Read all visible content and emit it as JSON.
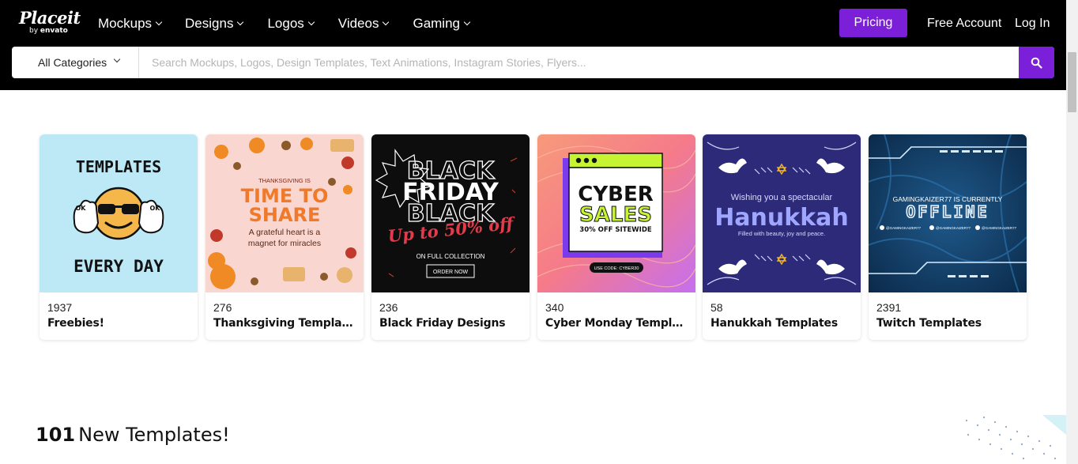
{
  "brand": {
    "name": "Placeit",
    "by": "by",
    "parent": "envato"
  },
  "nav": {
    "mockups": "Mockups",
    "designs": "Designs",
    "logos": "Logos",
    "videos": "Videos",
    "gaming": "Gaming"
  },
  "header": {
    "pricing": "Pricing",
    "free_account": "Free Account",
    "login": "Log In"
  },
  "search": {
    "category": "All Categories",
    "placeholder": "Search Mockups, Logos, Design Templates, Text Animations, Instagram Stories, Flyers..."
  },
  "colors": {
    "accent": "#7b1fd8",
    "header_bg": "#000000"
  },
  "cards": [
    {
      "count": "1937",
      "title": "Freebies!",
      "thumb": {
        "line1": "TEMPLATES",
        "line2": "EVERY DAY",
        "badge": "OK"
      }
    },
    {
      "count": "276",
      "title": "Thanksgiving Templates",
      "thumb": {
        "small": "THANKSGIVING IS",
        "big1": "TIME TO",
        "big2": "SHARE",
        "sub1": "A grateful heart is a",
        "sub2": "magnet for miracles"
      }
    },
    {
      "count": "236",
      "title": "Black Friday Designs",
      "thumb": {
        "l1": "BLACK",
        "l2": "FRIDAY",
        "l3": "BLACK",
        "promo": "Up to 50% off",
        "sub": "ON FULL COLLECTION",
        "btn": "ORDER NOW"
      }
    },
    {
      "count": "340",
      "title": "Cyber Monday Templates",
      "thumb": {
        "l1": "CYBER",
        "l2": "SALES",
        "l3": "30% OFF SITEWIDE",
        "code": "USE CODE: CYBER30"
      }
    },
    {
      "count": "58",
      "title": "Hanukkah Templates",
      "thumb": {
        "top": "Wishing you a spectacular",
        "big": "Hanukkah",
        "sub": "Filled with beauty, joy and peace."
      }
    },
    {
      "count": "2391",
      "title": "Twitch Templates",
      "thumb": {
        "top": "GAMINGKAIZER77 IS CURRENTLY",
        "big": "OFFLINE",
        "handle": "@GAMINGKAIZER77"
      }
    }
  ],
  "section": {
    "count": "101",
    "title": "New Templates!"
  }
}
